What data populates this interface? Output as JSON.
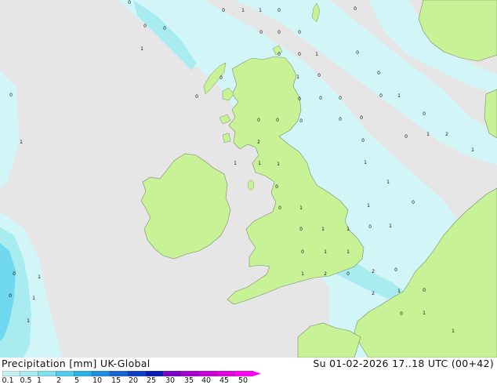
{
  "header": {
    "product_label": "Precipitation [mm]",
    "model_label": "UK-Global",
    "valid_time": "Su 01-02-2026 17..18 UTC (00+42)"
  },
  "legend": {
    "ticks": [
      "0.1",
      "0.5",
      "1",
      "2",
      "5",
      "10",
      "15",
      "20",
      "25",
      "30",
      "35",
      "40",
      "45",
      "50"
    ],
    "colors": [
      "#c8f0f0",
      "#a8ecf0",
      "#80e0ee",
      "#52ccec",
      "#2ab2e6",
      "#1c8fe0",
      "#1464d6",
      "#0c40c8",
      "#0a1cb4",
      "#7c00c8",
      "#a800d0",
      "#c800d8",
      "#e000e0",
      "#ff00f4"
    ]
  },
  "colors": {
    "sea": "#e6e6e6",
    "land": "#c8f296",
    "precip_light": "#d2f6f8",
    "precip_medium": "#a8ecf0",
    "precip_heavy": "#70d8ee"
  },
  "map_values": [
    {
      "v": "0"
    },
    {
      "v": "0"
    },
    {
      "v": "1"
    },
    {
      "v": "1"
    },
    {
      "v": "0"
    },
    {
      "v": "0"
    },
    {
      "v": "0"
    },
    {
      "v": "0"
    },
    {
      "v": "0"
    },
    {
      "v": "0"
    },
    {
      "v": "0"
    },
    {
      "v": "1"
    },
    {
      "v": "0"
    },
    {
      "v": "0"
    },
    {
      "v": "1"
    },
    {
      "v": "0"
    },
    {
      "v": "0"
    },
    {
      "v": "1"
    },
    {
      "v": "0"
    },
    {
      "v": "0"
    },
    {
      "v": "0"
    },
    {
      "v": "0"
    },
    {
      "v": "1"
    },
    {
      "v": "0"
    },
    {
      "v": "0"
    },
    {
      "v": "0"
    },
    {
      "v": "0"
    },
    {
      "v": "0"
    },
    {
      "v": "0"
    },
    {
      "v": "0"
    },
    {
      "v": "0"
    },
    {
      "v": "0"
    },
    {
      "v": "0"
    },
    {
      "v": "0"
    },
    {
      "v": "1"
    },
    {
      "v": "2"
    },
    {
      "v": "0"
    },
    {
      "v": "2"
    },
    {
      "v": "1"
    },
    {
      "v": "1"
    },
    {
      "v": "1"
    },
    {
      "v": "1"
    },
    {
      "v": "1"
    },
    {
      "v": "1"
    },
    {
      "v": "1"
    },
    {
      "v": "0"
    },
    {
      "v": "0"
    },
    {
      "v": "1"
    },
    {
      "v": "0"
    },
    {
      "v": "1"
    },
    {
      "v": "1"
    },
    {
      "v": "0"
    },
    {
      "v": "1"
    },
    {
      "v": "0"
    },
    {
      "v": "1"
    },
    {
      "v": "1"
    },
    {
      "v": "0"
    },
    {
      "v": "1"
    },
    {
      "v": "0"
    },
    {
      "v": "1"
    },
    {
      "v": "0"
    },
    {
      "v": "1"
    },
    {
      "v": "2"
    },
    {
      "v": "0"
    },
    {
      "v": "2"
    },
    {
      "v": "0"
    },
    {
      "v": "2"
    },
    {
      "v": "1"
    },
    {
      "v": "0"
    },
    {
      "v": "1"
    },
    {
      "v": "0"
    },
    {
      "v": "1"
    },
    {
      "v": "1"
    },
    {
      "v": "1"
    }
  ]
}
